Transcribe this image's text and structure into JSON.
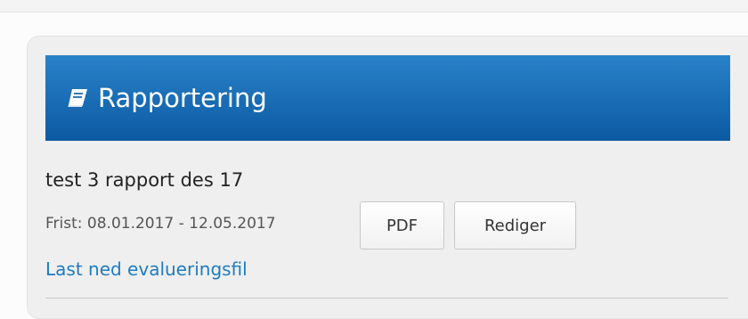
{
  "panel": {
    "title": "Rapportering",
    "icon": "book-icon",
    "header_color_top": "#2a82c9",
    "header_color_bottom": "#0b5aa2"
  },
  "report": {
    "title": "test 3 rapport des 17",
    "deadline": "Frist: 08.01.2017 - 12.05.2017",
    "pdf_label": "PDF",
    "edit_label": "Rediger",
    "evaluation_link": "Last ned evalueringsfil",
    "link_color": "#1f7cc0"
  }
}
